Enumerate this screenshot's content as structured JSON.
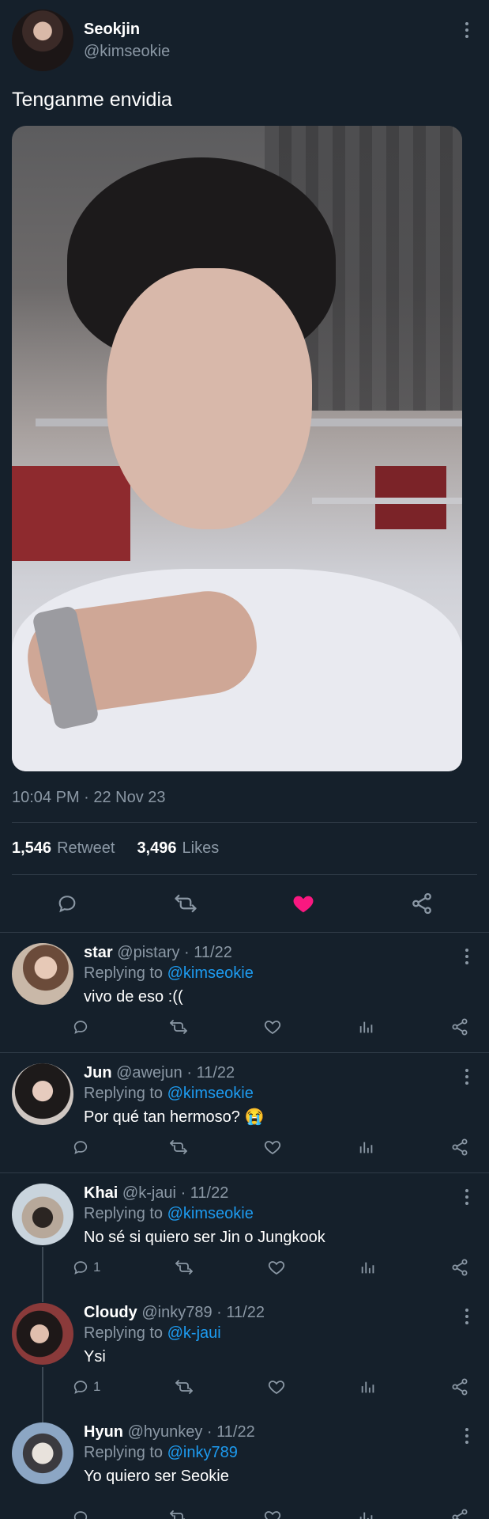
{
  "tweet": {
    "display_name": "Seokjin",
    "handle": "@kimseokie",
    "text": "Tenganme envidia",
    "timestamp": "10:04 PM · 22 Nov 23",
    "retweet_count": "1,546",
    "retweet_label": "Retweet",
    "likes_count": "3,496",
    "likes_label": "Likes",
    "liked": true
  },
  "colors": {
    "background": "#15202b",
    "muted": "#8b98a5",
    "link": "#1d9bf0",
    "like": "#f91880"
  },
  "replies": [
    {
      "name": "star",
      "handle": "@pistary",
      "date": "· 11/22",
      "replying_label": "Replying to",
      "replying_to": "@kimseokie",
      "text": "vivo de eso :((",
      "reply_count": ""
    },
    {
      "name": "Jun",
      "handle": "@awejun",
      "date": "· 11/22",
      "replying_label": "Replying to",
      "replying_to": "@kimseokie",
      "text": "Por qué tan hermoso? 😭",
      "reply_count": ""
    },
    {
      "name": "Khai",
      "handle": "@k-jaui",
      "date": "· 11/22",
      "replying_label": "Replying to",
      "replying_to": "@kimseokie",
      "text": "No sé si quiero ser Jin o Jungkook",
      "reply_count": "1"
    },
    {
      "name": "Cloudy",
      "handle": "@inky789",
      "date": "· 11/22",
      "replying_label": "Replying to",
      "replying_to": "@k-jaui",
      "text": "Ysi",
      "reply_count": "1"
    },
    {
      "name": "Hyun",
      "handle": "@hyunkey",
      "date": "· 11/22",
      "replying_label": "Replying to",
      "replying_to": "@inky789",
      "text": "Yo quiero ser Seokie",
      "reply_count": ""
    }
  ]
}
